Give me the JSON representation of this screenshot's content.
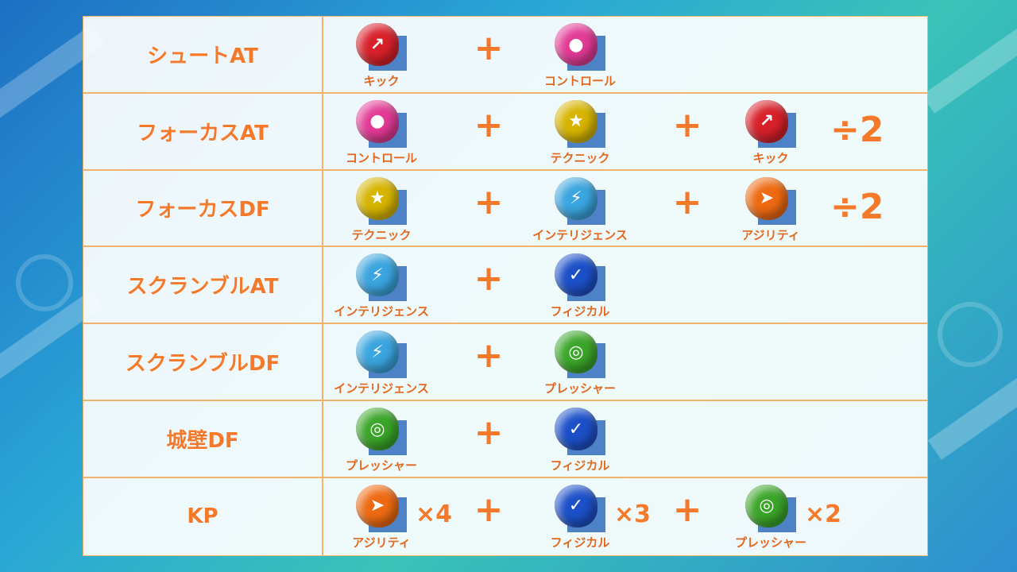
{
  "colors": {
    "accent": "#f4792a",
    "border": "#f0b36d",
    "kick": "#d8202a",
    "control": "#e23a95",
    "technique": "#d6b400",
    "intelligence": "#3aa5df",
    "agility": "#ee6a12",
    "physical": "#1c50c8",
    "pressure": "#3aa528"
  },
  "rows": [
    {
      "label": "シュートAT",
      "items": [
        {
          "name": "キック",
          "icon": "kick-boot-icon"
        },
        {
          "name": "コントロール",
          "icon": "control-ball-icon"
        }
      ]
    },
    {
      "label": "フォーカスAT",
      "items": [
        {
          "name": "コントロール",
          "icon": "control-ball-icon"
        },
        {
          "name": "テクニック",
          "icon": "technique-player-icon"
        },
        {
          "name": "キック",
          "icon": "kick-boot-icon"
        }
      ],
      "suffix": "÷2"
    },
    {
      "label": "フォーカスDF",
      "items": [
        {
          "name": "テクニック",
          "icon": "technique-player-icon"
        },
        {
          "name": "インテリジェンス",
          "icon": "intelligence-bulb-icon"
        },
        {
          "name": "アジリティ",
          "icon": "agility-runner-icon"
        }
      ],
      "suffix": "÷2"
    },
    {
      "label": "スクランブルAT",
      "items": [
        {
          "name": "インテリジェンス",
          "icon": "intelligence-bulb-icon"
        },
        {
          "name": "フィジカル",
          "icon": "physical-arm-icon"
        }
      ]
    },
    {
      "label": "スクランブルDF",
      "items": [
        {
          "name": "インテリジェンス",
          "icon": "intelligence-bulb-icon"
        },
        {
          "name": "プレッシャー",
          "icon": "pressure-wave-icon"
        }
      ]
    },
    {
      "label": "城壁DF",
      "items": [
        {
          "name": "プレッシャー",
          "icon": "pressure-wave-icon"
        },
        {
          "name": "フィジカル",
          "icon": "physical-arm-icon"
        }
      ]
    },
    {
      "label": "KP",
      "items": [
        {
          "name": "アジリティ",
          "icon": "agility-runner-icon",
          "mult": "×4"
        },
        {
          "name": "フィジカル",
          "icon": "physical-arm-icon",
          "mult": "×3"
        },
        {
          "name": "プレッシャー",
          "icon": "pressure-wave-icon",
          "mult": "×2"
        }
      ]
    }
  ],
  "plus_symbol": "+"
}
